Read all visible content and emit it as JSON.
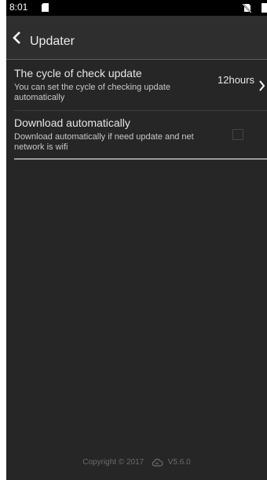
{
  "status_bar": {
    "time": "8:01",
    "icons": [
      "sd-card-icon",
      "no-sim-icon",
      "battery-icon"
    ]
  },
  "app_bar": {
    "back_icon": "chevron-left-icon",
    "title": "Updater"
  },
  "settings": {
    "cycle": {
      "title": "The cycle of check update",
      "subtitle": "You can set the cycle of checking update automatically",
      "value": "12hours",
      "icon": "chevron-right-icon"
    },
    "download": {
      "title": "Download automatically",
      "subtitle": "Download automatically if need update and net network is wifi",
      "checked": false
    }
  },
  "footer": {
    "copyright": "Copyright © 2017",
    "icon": "cloud-icon",
    "version": "V5.6.0"
  },
  "colors": {
    "background": "#262626",
    "app_bar": "#2e2e2e",
    "status_bar": "#000000",
    "accent_line": "#3d6a72",
    "text_primary": "#e6e6e6",
    "text_secondary": "#c8c8c8",
    "footer_text": "#6b6b6b"
  }
}
